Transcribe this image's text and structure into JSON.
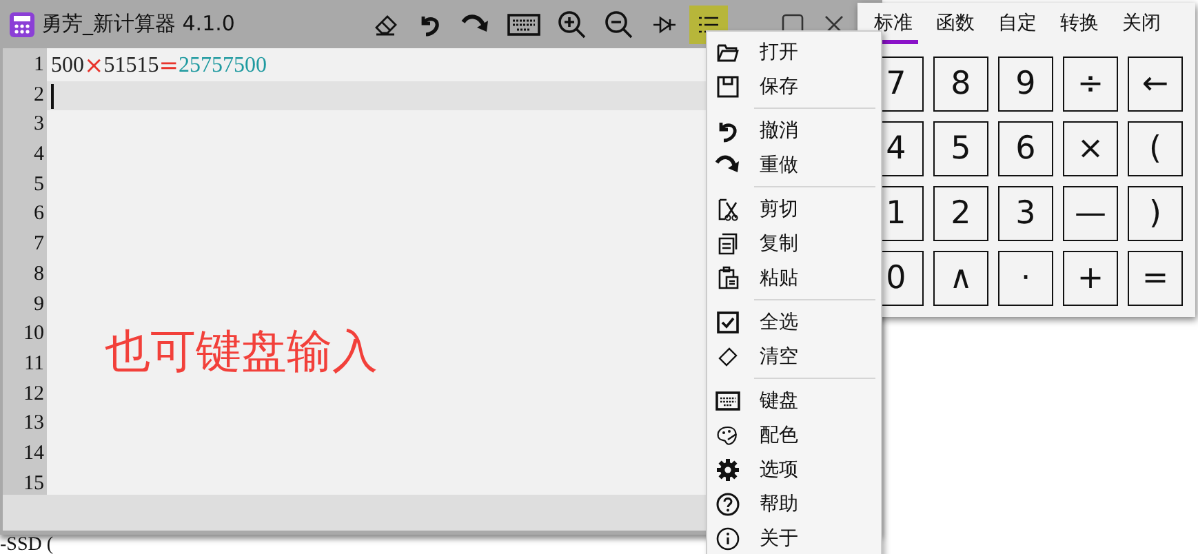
{
  "window": {
    "title": "勇芳_新计算器 4.1.0"
  },
  "editor": {
    "line_numbers": [
      "1",
      "2",
      "3",
      "4",
      "5",
      "6",
      "7",
      "8",
      "9",
      "10",
      "11",
      "12",
      "13",
      "14",
      "15"
    ],
    "lines": [
      {
        "current": false,
        "tokens": [
          {
            "kind": "number",
            "text": "500"
          },
          {
            "kind": "operator",
            "text": "×"
          },
          {
            "kind": "number",
            "text": "51515"
          },
          {
            "kind": "operator",
            "text": "="
          },
          {
            "kind": "result",
            "text": "25757500"
          }
        ]
      },
      {
        "current": true
      }
    ],
    "annotation": "也可键盘输入"
  },
  "menu": {
    "groups": [
      [
        {
          "label": "打开"
        },
        {
          "label": "保存"
        }
      ],
      [
        {
          "label": "撤消"
        },
        {
          "label": "重做"
        }
      ],
      [
        {
          "label": "剪切"
        },
        {
          "label": "复制"
        },
        {
          "label": "粘贴"
        }
      ],
      [
        {
          "label": "全选"
        },
        {
          "label": "清空"
        }
      ],
      [
        {
          "label": "键盘"
        },
        {
          "label": "配色"
        },
        {
          "label": "选项"
        },
        {
          "label": "帮助"
        },
        {
          "label": "关于"
        }
      ]
    ]
  },
  "keypad": {
    "tabs": [
      {
        "label": "标准",
        "selected": true
      },
      {
        "label": "函数",
        "selected": false
      },
      {
        "label": "自定",
        "selected": false
      },
      {
        "label": "转换",
        "selected": false
      },
      {
        "label": "关闭",
        "selected": false
      }
    ],
    "keys": [
      [
        "7",
        "8",
        "9",
        "÷",
        "←"
      ],
      [
        "4",
        "5",
        "6",
        "×",
        "("
      ],
      [
        "1",
        "2",
        "3",
        "—",
        ")"
      ],
      [
        "0",
        "∧",
        "·",
        "+",
        "="
      ]
    ]
  },
  "background": {
    "drive_label": "-SSD ("
  }
}
